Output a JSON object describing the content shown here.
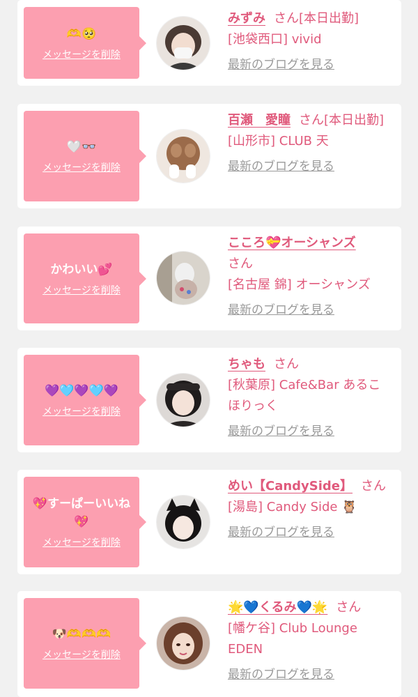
{
  "accent_color": "#fc9fb0",
  "name_color": "#e05a7c",
  "items": [
    {
      "message": "🫶🥺",
      "delete_label": "メッセージを削除",
      "name": "みずみ",
      "san": "さん",
      "status": "[本日出勤]",
      "shop": "[池袋西口] vivid",
      "blog_label": "最新のブログを見る",
      "avatar": "avatar-photo"
    },
    {
      "message": "🤍👓",
      "delete_label": "メッセージを削除",
      "name": "百瀬　愛瞳",
      "san": "さん",
      "status": "[本日出勤]",
      "shop": "[山形市] CLUB 天",
      "blog_label": "最新のブログを見る",
      "avatar": "avatar-photo"
    },
    {
      "message": "かわいい💕",
      "delete_label": "メッセージを削除",
      "name": "こころ💝オーシャンズ",
      "san": "さん",
      "status": "",
      "shop": "[名古屋 錦] オーシャンズ",
      "blog_label": "最新のブログを見る",
      "avatar": "avatar-photo"
    },
    {
      "message": "💜🩵💜🩵💜",
      "delete_label": "メッセージを削除",
      "name": "ちゃも",
      "san": "さん",
      "status": "",
      "shop": "[秋葉原] Cafe&Bar あるこほりっく",
      "blog_label": "最新のブログを見る",
      "avatar": "avatar-photo"
    },
    {
      "message": "💖すーぱーいいね💖",
      "delete_label": "メッセージを削除",
      "name": "めい【CandySide】",
      "san": "さん",
      "status": "",
      "shop": "[湯島] Candy Side 🦉",
      "blog_label": "最新のブログを見る",
      "avatar": "avatar-photo"
    },
    {
      "message": "🐶🫶🫶🫶",
      "delete_label": "メッセージを削除",
      "name": "🌟💙くるみ💙🌟",
      "san": "さん",
      "status": "",
      "shop": "[幡ケ谷] Club Lounge EDEN",
      "blog_label": "最新のブログを見る",
      "avatar": "avatar-photo"
    }
  ]
}
